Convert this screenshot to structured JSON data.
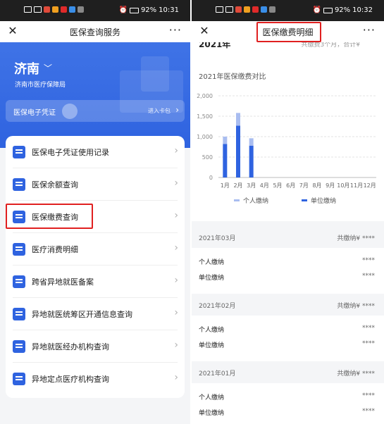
{
  "left": {
    "statusbar": {
      "left_icons": "HD ᴴᴰ ⁴G ‧",
      "time": "10:31",
      "battery": "92%"
    },
    "navbar": {
      "title": "医保查询服务",
      "more": "···",
      "close": "✕"
    },
    "header": {
      "city": "济南",
      "bureau": "济南市医疗保障局"
    },
    "card": {
      "label": "医保电子凭证",
      "enter": "进入卡包"
    },
    "menu": [
      {
        "label": "医保电子凭证使用记录",
        "icon": "certificate-record-icon"
      },
      {
        "label": "医保余额查询",
        "icon": "balance-icon"
      },
      {
        "label": "医保缴费查询",
        "icon": "payment-query-icon"
      },
      {
        "label": "医疗消费明细",
        "icon": "consumption-detail-icon"
      },
      {
        "label": "跨省异地就医备案",
        "icon": "cross-province-icon"
      },
      {
        "label": "异地就医统筹区开通信息查询",
        "icon": "remote-info-icon"
      },
      {
        "label": "异地就医经办机构查询",
        "icon": "agency-icon"
      },
      {
        "label": "异地定点医疗机构查询",
        "icon": "hospital-icon"
      }
    ]
  },
  "right": {
    "statusbar": {
      "time": "10:32",
      "battery": "92%"
    },
    "navbar": {
      "title": "医保缴费明细",
      "more": "···",
      "close": "✕"
    },
    "year": {
      "label": "2021年",
      "summary": "共缴费3个月，合计¥"
    },
    "chart_title": "2021年医保缴费对比",
    "legend": {
      "personal": "个人缴纳",
      "employer": "单位缴纳"
    },
    "records": [
      {
        "month": "2021年03月",
        "total": "共缴纳¥ ****",
        "personal_label": "个人缴纳",
        "personal": "****",
        "employer_label": "单位缴纳",
        "employer": "****"
      },
      {
        "month": "2021年02月",
        "total": "共缴纳¥ ****",
        "personal_label": "个人缴纳",
        "personal": "****",
        "employer_label": "单位缴纳",
        "employer": "****"
      },
      {
        "month": "2021年01月",
        "total": "共缴纳¥ ****",
        "personal_label": "个人缴纳",
        "personal": "****",
        "employer_label": "单位缴纳",
        "employer": "****"
      }
    ]
  },
  "colors": {
    "primary": "#2f63e0",
    "bar_light": "#a9bdf0",
    "highlight": "#e02020"
  },
  "chart_data": {
    "type": "bar",
    "title": "2021年医保缴费对比",
    "categories": [
      "1月",
      "2月",
      "3月",
      "4月",
      "5月",
      "6月",
      "7月",
      "8月",
      "9月",
      "10月",
      "11月",
      "12月"
    ],
    "y_ticks": [
      "0",
      "500",
      "1,000",
      "1,500",
      "2,000"
    ],
    "ylim": [
      0,
      2000
    ],
    "stacked": true,
    "series": [
      {
        "name": "单位缴纳",
        "color": "#2f63e0",
        "values": [
          820,
          1270,
          780,
          0,
          0,
          0,
          0,
          0,
          0,
          0,
          0,
          0
        ]
      },
      {
        "name": "个人缴纳",
        "color": "#a9bdf0",
        "values": [
          180,
          310,
          180,
          0,
          0,
          0,
          0,
          0,
          0,
          0,
          0,
          0
        ]
      }
    ],
    "legend_position": "bottom",
    "grid": true
  }
}
